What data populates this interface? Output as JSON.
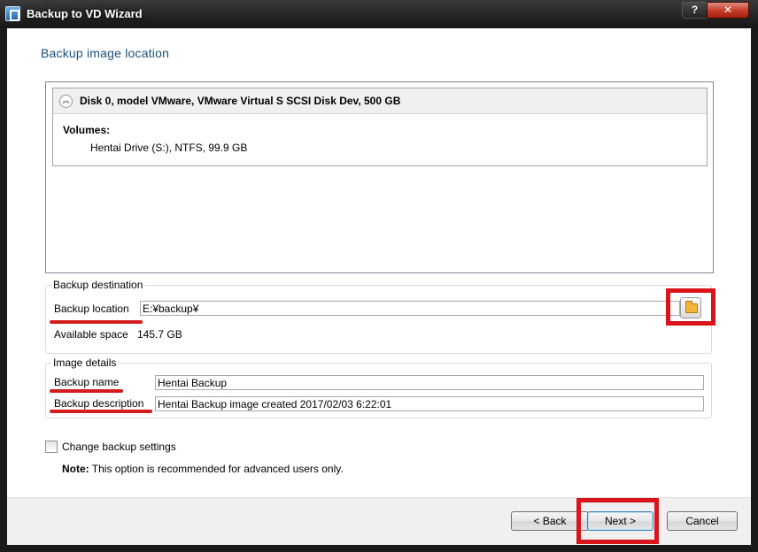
{
  "window": {
    "title": "Backup to VD Wizard",
    "help_label": "?",
    "close_label": "✕"
  },
  "heading": "Backup image location",
  "disk": {
    "title": "Disk 0, model VMware, VMware Virtual S SCSI Disk Dev, 500 GB",
    "collapse_glyph": "︽",
    "volumes_label": "Volumes:",
    "volumes": [
      "Hentai Drive (S:), NTFS, 99.9 GB"
    ]
  },
  "destination": {
    "group_label": "Backup destination",
    "location_label": "Backup location",
    "location_value": "E:¥backup¥",
    "available_label": "Available space",
    "available_value": "145.7 GB"
  },
  "image_details": {
    "group_label": "Image details",
    "name_label": "Backup name",
    "name_value": "Hentai Backup",
    "description_label": "Backup description",
    "description_value": "Hentai Backup image created 2017/02/03 6:22:01"
  },
  "settings": {
    "checkbox_label": "Change backup settings",
    "checked": false,
    "note_label": "Note:",
    "note_text": " This option is recommended for advanced users only."
  },
  "buttons": {
    "back": "< Back",
    "next": "Next >",
    "cancel": "Cancel"
  },
  "annotation_color": "#d9141b",
  "icons": [
    "app-icon",
    "collapse-icon",
    "folder-icon"
  ]
}
